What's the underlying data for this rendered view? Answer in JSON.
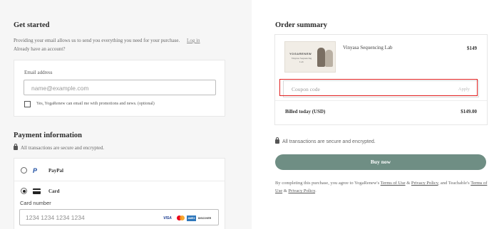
{
  "get_started": {
    "heading": "Get started",
    "info": "Providing your email allows us to send you everything you need for your purchase.",
    "login_link": "Log in",
    "account_prompt": "Already have an account?"
  },
  "email_form": {
    "label": "Email address",
    "placeholder": "name@example.com",
    "optin_label": "Yes, YogaRenew can email me with promotions and news. (optional)",
    "optin_checked": false
  },
  "payment": {
    "heading": "Payment information",
    "secure_note": "All transactions are secure and encrypted.",
    "methods": [
      {
        "label": "PayPal",
        "icon": "paypal-icon",
        "selected": false
      },
      {
        "label": "Card",
        "icon": "credit-card-icon",
        "selected": true
      }
    ],
    "card_number_label": "Card number",
    "card_number_placeholder": "1234 1234 1234 1234",
    "card_brands": [
      "VISA",
      "Mastercard",
      "AMEX",
      "DISCOVER"
    ]
  },
  "order_summary": {
    "heading": "Order summary",
    "product": {
      "name": "Vinyasa Sequencing Lab",
      "price": "$149",
      "thumb_logo": "YOGARENEW",
      "thumb_sub": "Vinyasa Sequencing Lab"
    },
    "coupon_placeholder": "Coupon code",
    "coupon_apply": "Apply",
    "billed_label": "Billed today (USD)",
    "billed_amount": "$149.00"
  },
  "checkout": {
    "secure_note": "All transactions are secure and encrypted.",
    "buy_button": "Buy now",
    "terms_prefix": "By completing this purchase, you agree to YogaRenew's",
    "terms_link": "Terms of Use",
    "and1": "&",
    "privacy_link": "Privacy Policy",
    "terms_mid": ", and Teachable's",
    "teachable_terms_link": "Terms of Use",
    "and2": "&",
    "teachable_privacy_link": "Privacy Policy",
    "terms_end": "."
  },
  "colors": {
    "buy_button": "#6f8e84",
    "highlight": "#e02020",
    "left_panel_bg": "#f6f6f6"
  }
}
